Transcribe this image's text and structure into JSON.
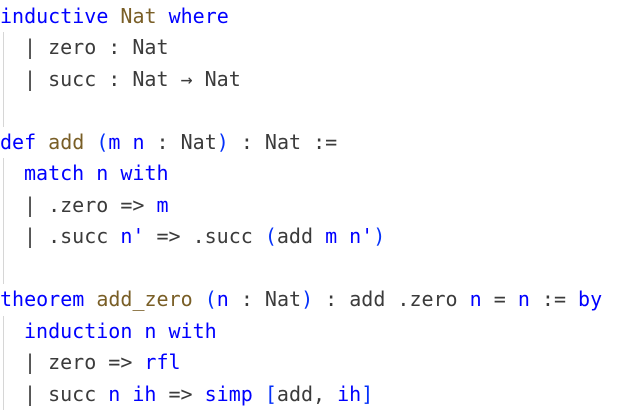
{
  "editor": {
    "lines": [
      {
        "parts": [
          {
            "t": "inductive",
            "c": "kw"
          },
          {
            "t": " ",
            "c": "pun"
          },
          {
            "t": "Nat",
            "c": "def"
          },
          {
            "t": " ",
            "c": "pun"
          },
          {
            "t": "where",
            "c": "kw"
          }
        ]
      },
      {
        "indent": 1,
        "parts": [
          {
            "t": "| zero : Nat",
            "c": "pun"
          }
        ]
      },
      {
        "indent": 1,
        "parts": [
          {
            "t": "| succ : Nat → Nat",
            "c": "pun"
          }
        ]
      },
      {
        "indent": 1,
        "parts": []
      },
      {
        "parts": [
          {
            "t": "def",
            "c": "kw"
          },
          {
            "t": " ",
            "c": "pun"
          },
          {
            "t": "add",
            "c": "def"
          },
          {
            "t": " ",
            "c": "pun"
          },
          {
            "t": "(",
            "c": "bracket"
          },
          {
            "t": "m n",
            "c": "var"
          },
          {
            "t": " : Nat",
            "c": "pun"
          },
          {
            "t": ")",
            "c": "bracket"
          },
          {
            "t": " : Nat :=",
            "c": "pun"
          }
        ]
      },
      {
        "indent": 1,
        "parts": [
          {
            "t": "match",
            "c": "kw"
          },
          {
            "t": " ",
            "c": "pun"
          },
          {
            "t": "n",
            "c": "var"
          },
          {
            "t": " ",
            "c": "pun"
          },
          {
            "t": "with",
            "c": "kw"
          }
        ]
      },
      {
        "indent": 1,
        "parts": [
          {
            "t": "| .zero => ",
            "c": "pun"
          },
          {
            "t": "m",
            "c": "var"
          }
        ]
      },
      {
        "indent": 1,
        "parts": [
          {
            "t": "| .succ ",
            "c": "pun"
          },
          {
            "t": "n'",
            "c": "var"
          },
          {
            "t": " => .succ ",
            "c": "pun"
          },
          {
            "t": "(",
            "c": "bracket"
          },
          {
            "t": "add ",
            "c": "pun"
          },
          {
            "t": "m n'",
            "c": "var"
          },
          {
            "t": ")",
            "c": "bracket"
          }
        ]
      },
      {
        "indent": 1,
        "parts": []
      },
      {
        "parts": [
          {
            "t": "theorem",
            "c": "kw"
          },
          {
            "t": " ",
            "c": "pun"
          },
          {
            "t": "add_zero",
            "c": "def"
          },
          {
            "t": " ",
            "c": "pun"
          },
          {
            "t": "(",
            "c": "bracket"
          },
          {
            "t": "n",
            "c": "var"
          },
          {
            "t": " : Nat",
            "c": "pun"
          },
          {
            "t": ")",
            "c": "bracket"
          },
          {
            "t": " : add .zero ",
            "c": "pun"
          },
          {
            "t": "n",
            "c": "var"
          },
          {
            "t": " = ",
            "c": "pun"
          },
          {
            "t": "n",
            "c": "var"
          },
          {
            "t": " := ",
            "c": "pun"
          },
          {
            "t": "by",
            "c": "kw"
          }
        ]
      },
      {
        "indent": 1,
        "parts": [
          {
            "t": "induction",
            "c": "kw"
          },
          {
            "t": " ",
            "c": "pun"
          },
          {
            "t": "n",
            "c": "var"
          },
          {
            "t": " ",
            "c": "pun"
          },
          {
            "t": "with",
            "c": "kw"
          }
        ]
      },
      {
        "indent": 1,
        "parts": [
          {
            "t": "| zero => ",
            "c": "pun"
          },
          {
            "t": "rfl",
            "c": "kw"
          }
        ]
      },
      {
        "indent": 1,
        "parts": [
          {
            "t": "| succ ",
            "c": "pun"
          },
          {
            "t": "n ih",
            "c": "var"
          },
          {
            "t": " => ",
            "c": "pun"
          },
          {
            "t": "simp",
            "c": "kw"
          },
          {
            "t": " ",
            "c": "pun"
          },
          {
            "t": "[",
            "c": "bracket"
          },
          {
            "t": "add, ",
            "c": "pun"
          },
          {
            "t": "ih",
            "c": "var"
          },
          {
            "t": "]",
            "c": "bracket"
          }
        ]
      }
    ]
  }
}
